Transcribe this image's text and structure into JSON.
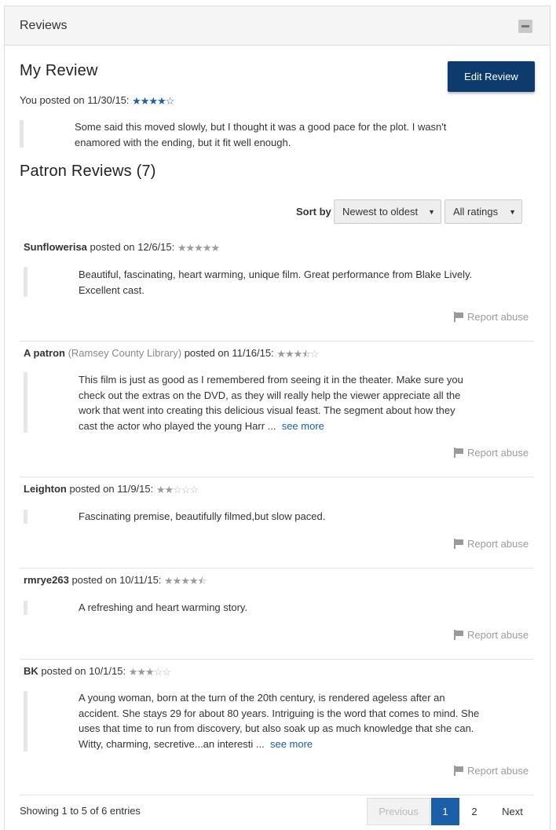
{
  "panel": {
    "title": "Reviews"
  },
  "my_review": {
    "heading": "My Review",
    "edit_label": "Edit Review",
    "posted_prefix": "You posted on 11/30/15:",
    "rating": 4,
    "text": "Some said this moved slowly, but I thought it was a good pace for the plot. I wasn't enamored with the ending, but it fit well enough."
  },
  "patron": {
    "heading": "Patron Reviews (7)",
    "sort_label": "Sort by",
    "sort_value": "Newest to oldest",
    "rating_filter_value": "All ratings"
  },
  "reviews": [
    {
      "author": "Sunflowerisa",
      "library": "",
      "posted": " posted on 12/6/15:",
      "rating": 5,
      "text": "Beautiful, fascinating, heart warming, unique film. Great performance from Blake Lively. Excellent cast.",
      "see_more": "",
      "report": "Report abuse"
    },
    {
      "author": "A patron",
      "library": "(Ramsey County Library)",
      "posted": " posted on 11/16/15:",
      "rating": 3.5,
      "text": "This film is just as good as I remembered from seeing it in the theater. Make sure you check out the extras on the DVD, as they will really help the viewer appreciate all the work that went into creating this delicious visual feast. The segment about how they cast the actor who played the young Harr ...",
      "see_more": "see more",
      "report": "Report abuse"
    },
    {
      "author": "Leighton",
      "library": "",
      "posted": " posted on 11/9/15:",
      "rating": 2,
      "text": "Fascinating premise, beautifully filmed,but slow paced.",
      "see_more": "",
      "report": "Report abuse"
    },
    {
      "author": "rmrye263",
      "library": "",
      "posted": " posted on 10/11/15:",
      "rating": 4.5,
      "text": "A refreshing and heart warming story.",
      "see_more": "",
      "report": "Report abuse"
    },
    {
      "author": "BK",
      "library": "",
      "posted": " posted on 10/1/15:",
      "rating": 3,
      "text": "A young woman, born at the turn of the 20th century, is rendered ageless after an accident. She stays 29 for about 80 years. Intriguing is the word that comes to mind. She uses that time to run from discovery, but also soak up as much knowledge that she can. Witty, charming, secretive...an interesti ...",
      "see_more": "see more",
      "report": "Report abuse"
    }
  ],
  "pagination": {
    "summary": "Showing 1 to 5 of 6 entries",
    "previous": "Previous",
    "pages": [
      "1",
      "2"
    ],
    "current": "1",
    "next": "Next"
  },
  "colors": {
    "primary_button": "#0d3b6e",
    "link": "#1a5fa8",
    "star_mine": "#1a5fa8",
    "star_other": "#9b9b9b"
  },
  "icons": {
    "collapse": "minus-icon",
    "report": "flag-icon",
    "star": "star-icon"
  }
}
